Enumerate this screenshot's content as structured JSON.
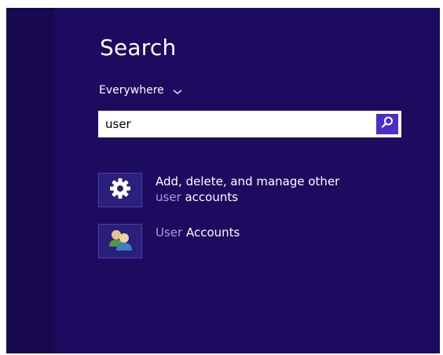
{
  "search_pane": {
    "title": "Search",
    "scope_label": "Everywhere",
    "query": "user",
    "search_button_icon": "magnifier-icon"
  },
  "results": [
    {
      "icon": "gear-icon",
      "line1": "Add, delete, and manage other",
      "line2_match": "user",
      "line2_rest": " accounts"
    },
    {
      "icon": "user-accounts-icon",
      "line1_match": "User",
      "line1_rest": " Accounts"
    }
  ],
  "colors": {
    "background": "#1d0b60",
    "accent": "#4a2ec8",
    "match_highlight": "#a99be0"
  }
}
